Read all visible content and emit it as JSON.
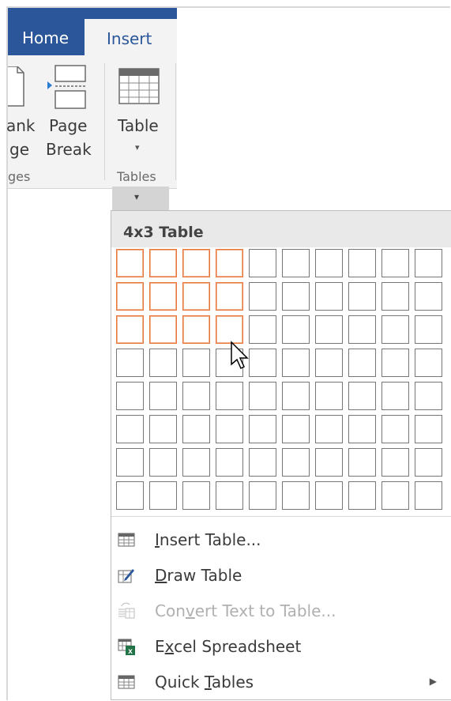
{
  "tabs": {
    "home": "Home",
    "insert": "Insert"
  },
  "ribbon": {
    "blank_page_top": "ank",
    "blank_page_bottom": "ge",
    "page_break_top": "Page",
    "page_break_bottom": "Break",
    "table_label": "Table",
    "pages_group": "ges",
    "tables_group": "Tables",
    "dropdown_arrow": "▾"
  },
  "table_picker": {
    "title": "4x3 Table",
    "cols": 10,
    "rows": 8,
    "selected_cols": 4,
    "selected_rows": 3
  },
  "menu": {
    "insert_table": {
      "pre": "",
      "ul": "I",
      "post": "nsert Table..."
    },
    "draw_table": {
      "pre": "",
      "ul": "D",
      "post": "raw Table"
    },
    "convert_text": {
      "pre": "Con",
      "ul": "v",
      "post": "ert Text to Table..."
    },
    "excel_sheet": {
      "pre": "E",
      "ul": "x",
      "post": "cel Spreadsheet"
    },
    "quick_tables": {
      "pre": "Quick ",
      "ul": "T",
      "post": "ables"
    },
    "submenu_arrow": "▶"
  },
  "colors": {
    "ribbon_blue": "#2b579a",
    "selected_cell": "#e8763a",
    "excel_green": "#217346"
  }
}
